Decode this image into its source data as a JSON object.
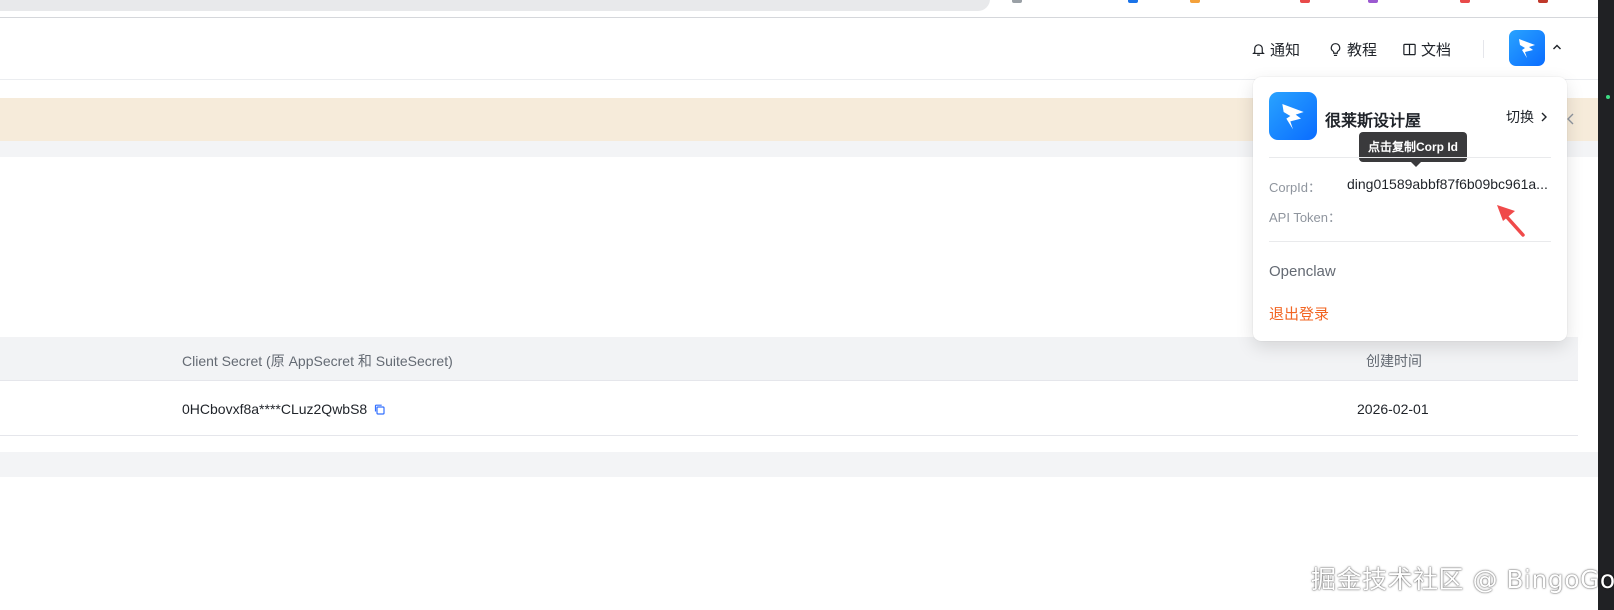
{
  "header": {
    "nav": [
      {
        "label": "通知",
        "icon": "bell-icon"
      },
      {
        "label": "教程",
        "icon": "lightbulb-icon"
      },
      {
        "label": "文档",
        "icon": "book-icon"
      }
    ]
  },
  "table": {
    "columns": [
      "Client Secret (原 AppSecret 和 SuiteSecret)",
      "创建时间"
    ],
    "rows": [
      {
        "client_secret": "0HCbovxf8a****CLuz2QwbS8",
        "created": "2026-02-01"
      }
    ]
  },
  "dropdown": {
    "org_name": "很莱斯设计屋",
    "switch_label": "切换",
    "tooltip": "点击复制Corp Id",
    "fields": [
      {
        "label": "CorpId：",
        "value": "ding01589abbf87f6b09bc961a..."
      },
      {
        "label": "API Token：",
        "value": ""
      }
    ],
    "menu_item": "Openclaw",
    "logout_label": "退出登录"
  },
  "colors": {
    "accent_blue": "#0a6cff",
    "logout_orange": "#f26522",
    "annotation_red": "#f04a4a",
    "notice_bg": "#f6ebda"
  },
  "watermark": "掘金技术社区 @ BingoGo"
}
